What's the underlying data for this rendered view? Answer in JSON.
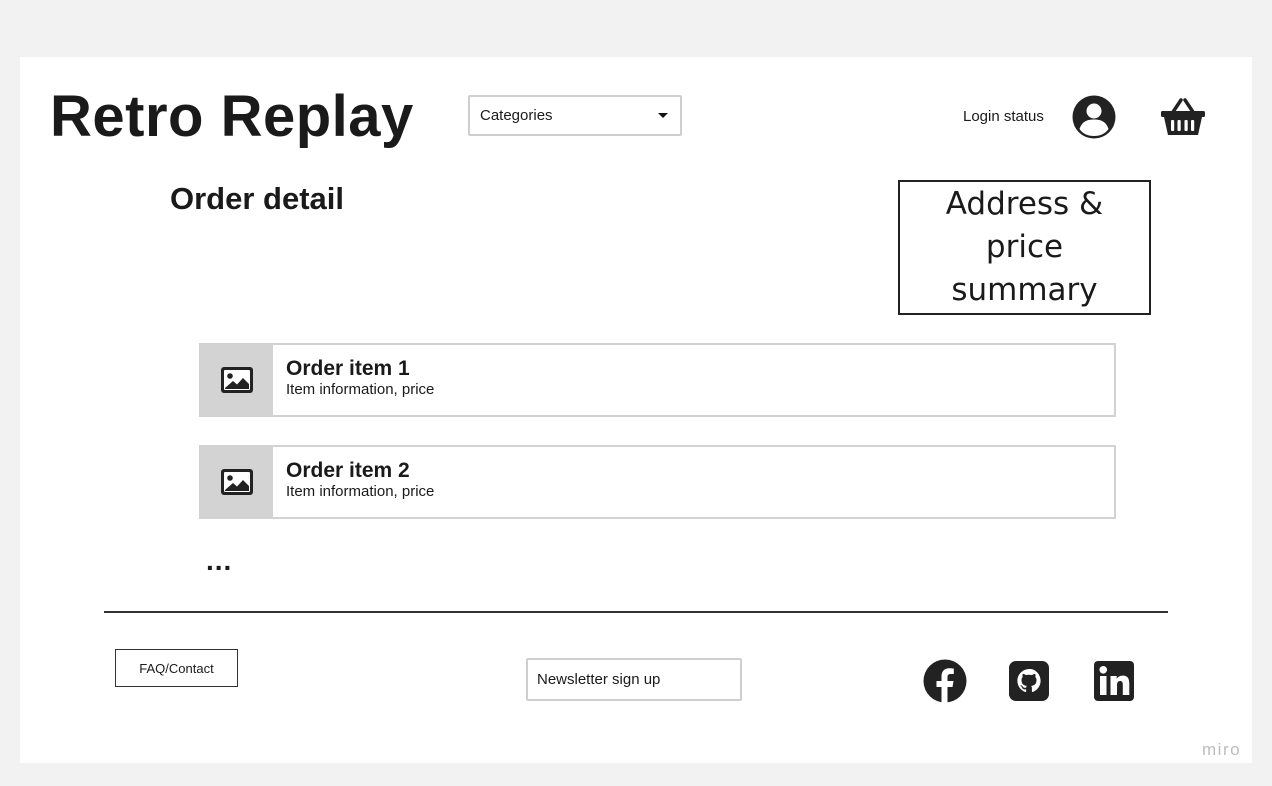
{
  "header": {
    "site_title": "Retro Replay",
    "categories_select": {
      "value": "Categories"
    },
    "login_status": "Login status",
    "user_icon": "user-circle-icon",
    "cart_icon": "shopping-basket-icon"
  },
  "main": {
    "page_title": "Order detail",
    "summary_box": "Address & price summary",
    "order_items": [
      {
        "name": "Order item 1",
        "info": "Item information, price",
        "thumbnail_icon": "image-placeholder-icon"
      },
      {
        "name": "Order item 2",
        "info": "Item information, price",
        "thumbnail_icon": "image-placeholder-icon"
      }
    ],
    "more_indicator": "..."
  },
  "footer": {
    "faq_contact_label": "FAQ/Contact",
    "newsletter_label": "Newsletter sign up",
    "social_icons": [
      "facebook-icon",
      "github-icon",
      "linkedin-icon"
    ]
  },
  "watermark": "miro",
  "colors": {
    "background": "#f2f2f2",
    "board": "#ffffff",
    "thumbnail_bg": "#d3d3d3",
    "text": "#1a1a1a"
  }
}
